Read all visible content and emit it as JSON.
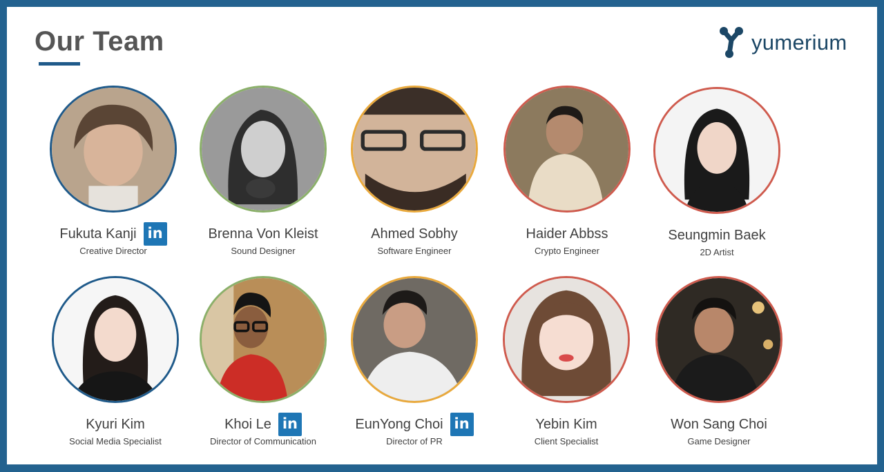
{
  "title": "Our Team",
  "brand": {
    "logo_text": "yumerium",
    "accent": "#1c4766"
  },
  "colors": {
    "frame": "#23628f",
    "blue": "#1f5a8a",
    "green": "#8bb06a",
    "orange": "#e9a93c",
    "red": "#cf5b4e",
    "linkedin": "#1e76b5"
  },
  "linkedin_label": "in",
  "members": [
    {
      "name": "Fukuta Kanji",
      "role": "Creative Director",
      "ring": "blue",
      "linkedin": true
    },
    {
      "name": "Brenna Von Kleist",
      "role": "Sound Designer",
      "ring": "green",
      "linkedin": false
    },
    {
      "name": "Ahmed Sobhy",
      "role": "Software Engineer",
      "ring": "orange",
      "linkedin": false
    },
    {
      "name": "Haider Abbss",
      "role": "Crypto Engineer",
      "ring": "red",
      "linkedin": false
    },
    {
      "name": "Seungmin Baek",
      "role": "2D Artist",
      "ring": "red",
      "linkedin": false
    },
    {
      "name": "Kyuri Kim",
      "role": "Social Media Specialist",
      "ring": "blue",
      "linkedin": false
    },
    {
      "name": "Khoi Le",
      "role": "Director of Communication",
      "ring": "green",
      "linkedin": true
    },
    {
      "name": "EunYong Choi",
      "role": "Director of PR",
      "ring": "orange",
      "linkedin": true
    },
    {
      "name": "Yebin Kim",
      "role": "Client Specialist",
      "ring": "red",
      "linkedin": false
    },
    {
      "name": "Won Sang Choi",
      "role": "Game Designer",
      "ring": "red",
      "linkedin": false
    }
  ]
}
